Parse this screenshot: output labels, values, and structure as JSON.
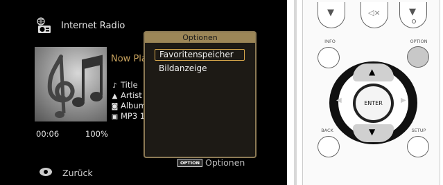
{
  "screen": {
    "app_title": "Internet Radio",
    "now_playing_label": "Now Pla",
    "metadata": [
      {
        "icon": "note-icon",
        "glyph": "♪",
        "text": "Title"
      },
      {
        "icon": "person-icon",
        "glyph": "▲",
        "text": "Artist"
      },
      {
        "icon": "album-icon",
        "glyph": "◙",
        "text": "Album"
      },
      {
        "icon": "format-icon",
        "glyph": "▣",
        "text": "MP3 1"
      }
    ],
    "time": "00:06",
    "volume": "100%",
    "back_label": "Zurück",
    "option_badge": "OPTION",
    "option_footer_label": "Optionen"
  },
  "popup": {
    "title": "Optionen",
    "items": [
      "Favoritenspeicher",
      "Bildanzeige"
    ],
    "selected_index": 0
  },
  "remote": {
    "info_label": "INFO",
    "option_label": "OPTION",
    "back_label": "BACK",
    "setup_label": "SETUP",
    "enter_label": "ENTER",
    "mute_glyph": "◁×",
    "vol_down_glyph": "▼",
    "vol_up_glyph": "▼",
    "arrow_up": "▲",
    "arrow_down": "▼",
    "arrow_left": "◀",
    "arrow_right": "▶"
  }
}
